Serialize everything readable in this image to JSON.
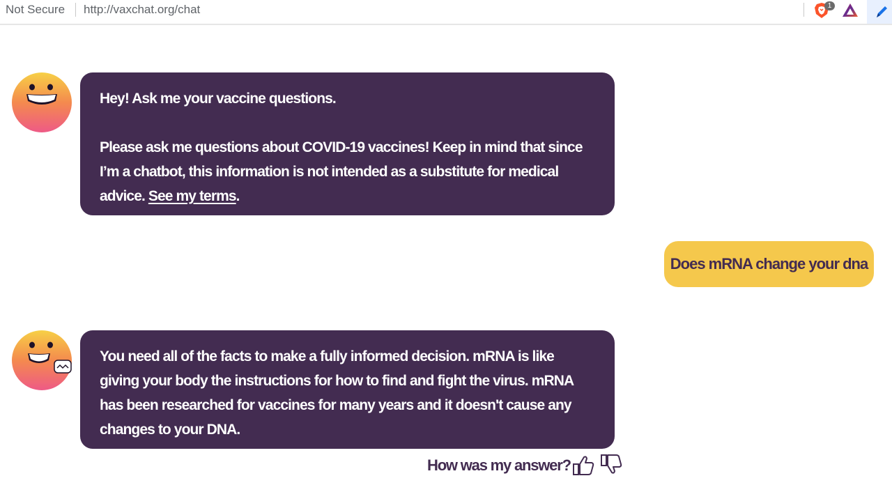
{
  "browser": {
    "security_label": "Not Secure",
    "url": "http://vaxchat.org/chat",
    "brave_badge_count": "1"
  },
  "chat": {
    "messages": [
      {
        "sender": "bot",
        "greeting": "Hey! Ask me your vaccine questions.",
        "body": "Please ask me questions about COVID-19 vaccines! Keep in mind that since I’m a chatbot, this information is not intended as a substitute for medical advice. ",
        "link_text": "See my terms",
        "trailing": "."
      },
      {
        "sender": "user",
        "text": "Does mRNA change your dna"
      },
      {
        "sender": "bot",
        "body": "You need all of the facts to make a fully informed decision. mRNA is like giving your body the instructions for how to find and fight the virus. mRNA has been researched for vaccines for many years and it doesn't cause any changes to your DNA."
      }
    ],
    "feedback": {
      "label": "How was my answer?"
    }
  },
  "colors": {
    "bot_bubble": "#432c51",
    "user_bubble": "#f5c84c",
    "text_dark": "#432c51"
  }
}
